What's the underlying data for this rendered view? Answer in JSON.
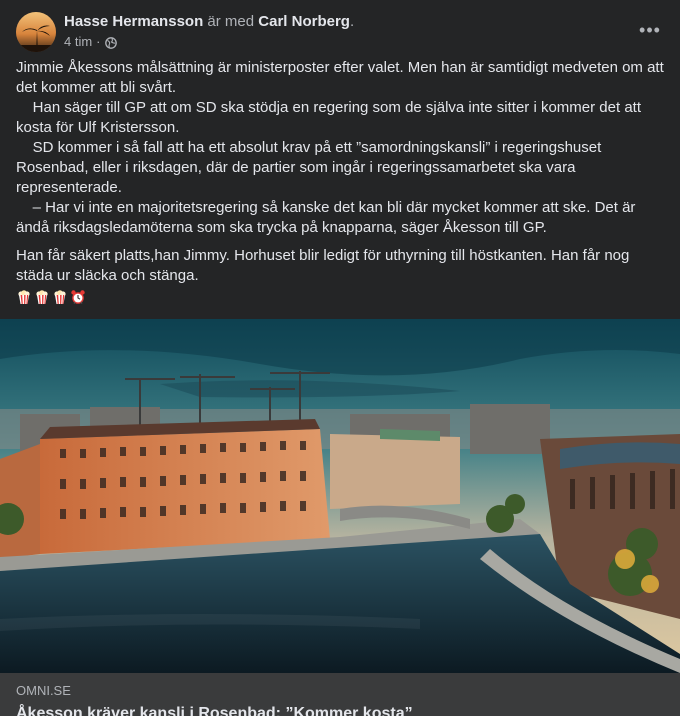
{
  "post": {
    "author": "Hasse Hermansson",
    "with_text": "är med",
    "tagged": "Carl Norberg",
    "tagged_suffix": ".",
    "time": "4 tim",
    "dot": "·",
    "privacy_icon": "globe-icon",
    "more_label": "•••",
    "paragraphs": [
      "Jimmie Åkessons målsättning är ministerposter efter valet. Men han är samtidigt medveten om att det kommer att bli svårt.\n    Han säger till GP att om SD ska stödja en regering som de själva inte sitter i kommer det att kosta för Ulf Kristersson.\n    SD kommer i så fall att ha ett absolut krav på ett ”samordningskansli” i regeringshuset Rosenbad, eller i riksdagen, där de partier som ingår i regeringssamarbetet ska vara representerade.\n    – Har vi inte en majoritetsregering så kanske det kan bli där mycket kommer att ske. Det är ändå riksdagsledamöterna som ska trycka på knapparna, säger Åkesson till GP.",
      "Han får säkert platts,han Jimmy. Horhuset blir ledigt för uthyrning till höstkanten. Han får nog städa ur släcka och stänga."
    ],
    "emojis": [
      "popcorn-icon",
      "popcorn-icon",
      "popcorn-icon",
      "alarm-clock-icon"
    ]
  },
  "link": {
    "domain": "OMNI.SE",
    "title": "Åkesson kräver kansli i Rosenbad: ”Kommer kosta”"
  }
}
